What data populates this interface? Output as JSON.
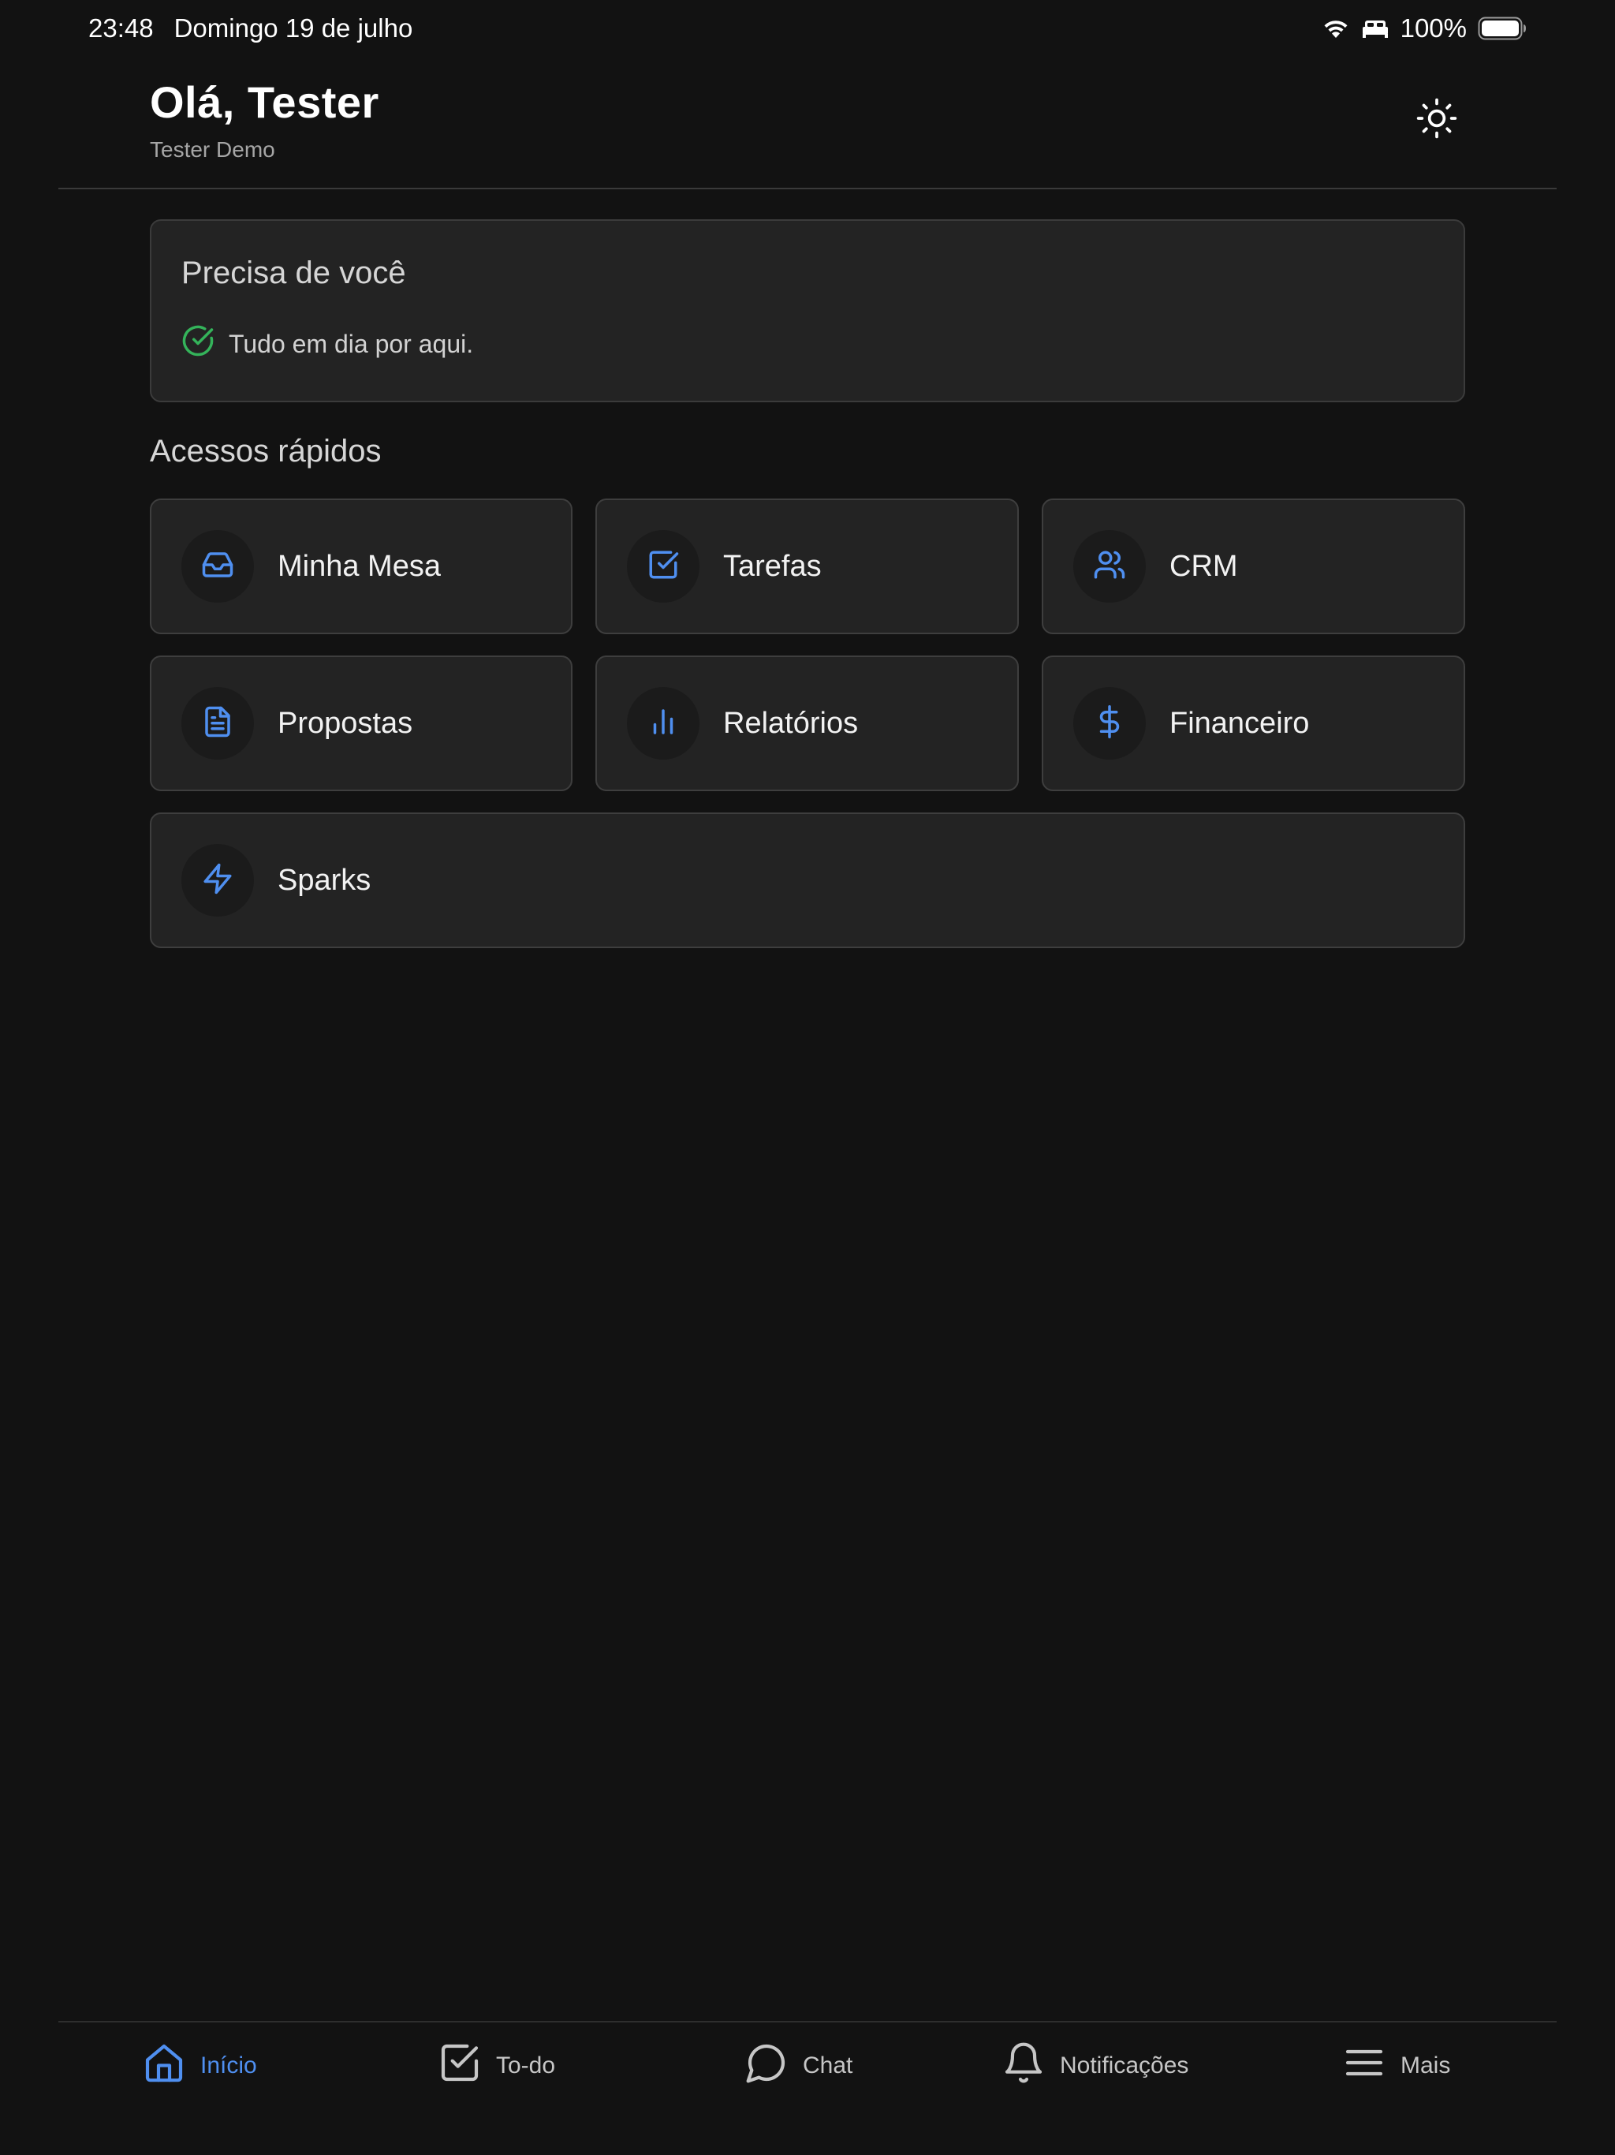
{
  "status_bar": {
    "time": "23:48",
    "date": "Domingo 19 de julho",
    "battery": "100%",
    "icons": [
      "wifi-icon",
      "sleep-focus-icon",
      "battery-icon"
    ]
  },
  "header": {
    "greeting": "Olá, Tester",
    "subtitle": "Tester Demo",
    "theme_icon": "sun-icon"
  },
  "needs_you": {
    "title": "Precisa de você",
    "status_text": "Tudo em dia por aqui.",
    "status_icon": "check-circle-icon",
    "status_color": "#34b35a"
  },
  "quick_access": {
    "title": "Acessos rápidos",
    "items": [
      {
        "label": "Minha Mesa",
        "icon": "inbox-icon"
      },
      {
        "label": "Tarefas",
        "icon": "checkbox-icon"
      },
      {
        "label": "CRM",
        "icon": "users-icon"
      },
      {
        "label": "Propostas",
        "icon": "document-icon"
      },
      {
        "label": "Relatórios",
        "icon": "bar-chart-icon"
      },
      {
        "label": "Financeiro",
        "icon": "dollar-icon"
      },
      {
        "label": "Sparks",
        "icon": "lightning-icon"
      }
    ]
  },
  "bottom_nav": {
    "items": [
      {
        "label": "Início",
        "icon": "home-icon",
        "active": true
      },
      {
        "label": "To-do",
        "icon": "checkbox-icon",
        "active": false
      },
      {
        "label": "Chat",
        "icon": "chat-bubble-icon",
        "active": false
      },
      {
        "label": "Notificações",
        "icon": "bell-icon",
        "active": false
      },
      {
        "label": "Mais",
        "icon": "menu-icon",
        "active": false
      }
    ]
  },
  "colors": {
    "accent": "#4f8ff0",
    "background": "#121212",
    "card": "#232323",
    "success": "#34b35a"
  }
}
